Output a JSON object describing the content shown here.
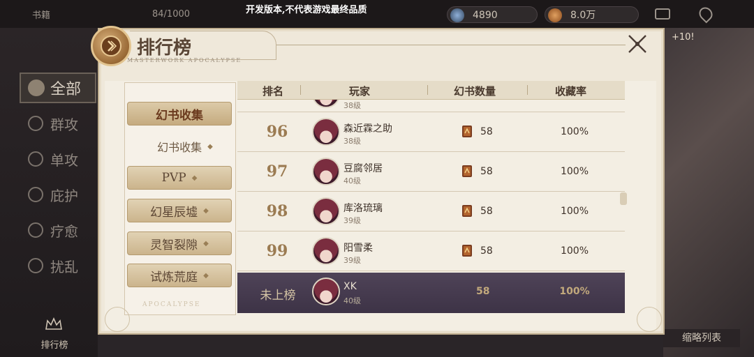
{
  "dev_notice": "开发版本,不代表游戏最终品质",
  "topbar": {
    "left_label": "书籍",
    "capacity": "84/1000",
    "currency1": "4890",
    "currency2": "8.0万",
    "bonus": "+10!"
  },
  "background_sidebar": {
    "all": "全部",
    "categories": [
      "群攻",
      "单攻",
      "庇护",
      "疗愈",
      "扰乱"
    ],
    "bottom_label": "排行榜",
    "right_bottom": "缩略列表"
  },
  "panel": {
    "title": "排行榜",
    "subtitle": "MASTERWORK APOCALYPSE",
    "bottom_watermark": "APOCALYPSE"
  },
  "tabs": [
    {
      "label": "幻书收集",
      "active": true
    },
    {
      "label": "PVP",
      "active": false
    },
    {
      "label": "幻星辰墟",
      "active": false
    },
    {
      "label": "灵智裂隙",
      "active": false
    },
    {
      "label": "试炼荒庭",
      "active": false
    }
  ],
  "subtab": {
    "label": "幻书收集"
  },
  "table": {
    "headers": [
      "排名",
      "玩家",
      "幻书数量",
      "收藏率"
    ],
    "partial_level": "38级",
    "rows": [
      {
        "rank": "96",
        "name": "森近霖之助",
        "level": "38级",
        "count": "58",
        "rate": "100%"
      },
      {
        "rank": "97",
        "name": "豆腐邻居",
        "level": "40级",
        "count": "58",
        "rate": "100%"
      },
      {
        "rank": "98",
        "name": "库洛琉璃",
        "level": "39级",
        "count": "58",
        "rate": "100%"
      },
      {
        "rank": "99",
        "name": "阳雪柔",
        "level": "39级",
        "count": "58",
        "rate": "100%"
      }
    ],
    "self": {
      "rank": "未上榜",
      "name": "XK",
      "level": "40级",
      "count": "58",
      "rate": "100%"
    }
  },
  "colors": {
    "accent": "#9b7b52",
    "self_row": "#4a3f52"
  }
}
